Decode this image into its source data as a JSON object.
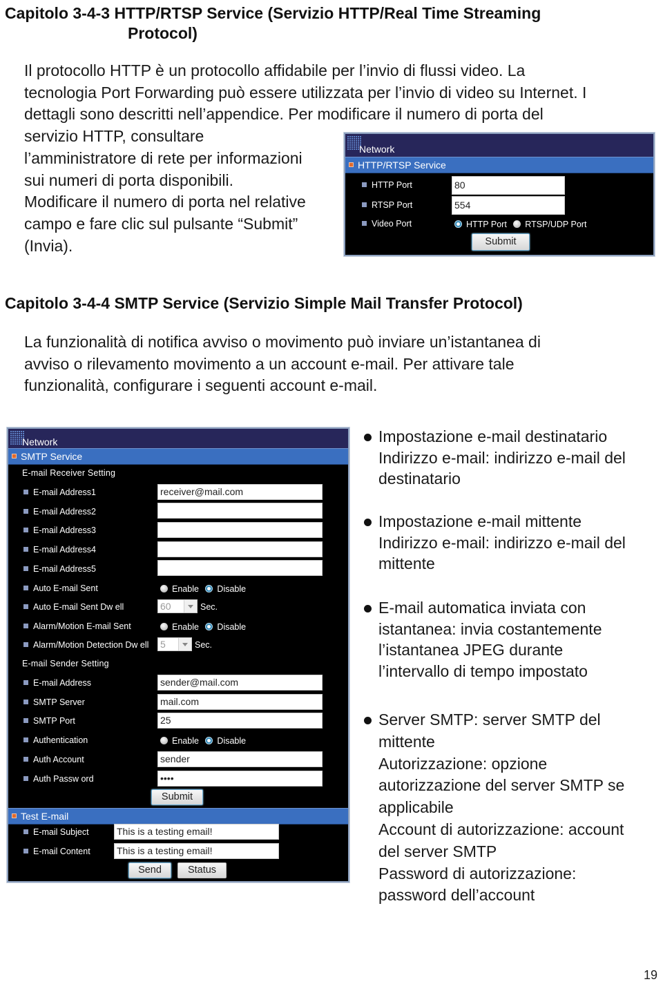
{
  "section1": {
    "title_line1": "Capitolo 3-4-3 HTTP/RTSP Service (Servizio HTTP/Real Time Streaming",
    "title_line2": "Protocol)",
    "paragraph_lines": [
      "Il protocollo HTTP è un protocollo affidabile per l’invio di flussi video. La",
      "tecnologia Port Forwarding può essere utilizzata per l’invio di video su Internet. I",
      "dettagli sono descritti nell’appendice. Per modificare il numero di porta del",
      "servizio HTTP, consultare",
      "l’amministratore di rete per informazioni",
      "sui numeri di porta disponibili.",
      "Modificare il numero di porta nel relative",
      "campo e fare clic sul pulsante “Submit”",
      "(Invia)."
    ],
    "panel": {
      "header": "Network",
      "section_title": "HTTP/RTSP Service",
      "rows": [
        {
          "label": "HTTP Port",
          "value": "80"
        },
        {
          "label": "RTSP Port",
          "value": "554"
        }
      ],
      "video_port": {
        "label": "Video Port",
        "options": [
          "HTTP Port",
          "RTSP/UDP Port"
        ],
        "selected": "HTTP Port"
      },
      "submit_label": "Submit"
    }
  },
  "section2": {
    "title": "Capitolo 3-4-4 SMTP Service (Servizio Simple Mail Transfer Protocol)",
    "paragraph_lines": [
      "La funzionalità di notifica avviso o movimento può inviare un’istantanea di",
      "avviso o rilevamento movimento a un account e-mail. Per attivare tale",
      "funzionalità, configurare i seguenti account e-mail."
    ],
    "panel": {
      "header": "Network",
      "section_title": "SMTP Service",
      "receiver_heading": "E-mail Receiver Setting",
      "receiver_rows": [
        {
          "label": "E-mail Address1",
          "value": "receiver@mail.com"
        },
        {
          "label": "E-mail Address2",
          "value": ""
        },
        {
          "label": "E-mail Address3",
          "value": ""
        },
        {
          "label": "E-mail Address4",
          "value": ""
        },
        {
          "label": "E-mail Address5",
          "value": ""
        }
      ],
      "auto_email": {
        "label": "Auto E-mail Sent",
        "enable": "Enable",
        "disable": "Disable",
        "selected": "Disable"
      },
      "auto_dwell": {
        "label": "Auto E-mail Sent Dw ell",
        "value": "60",
        "unit": "Sec."
      },
      "alarm_email": {
        "label": "Alarm/Motion E-mail Sent",
        "enable": "Enable",
        "disable": "Disable",
        "selected": "Disable"
      },
      "alarm_dwell": {
        "label": "Alarm/Motion Detection Dw ell",
        "value": "5",
        "unit": "Sec."
      },
      "sender_heading": "E-mail Sender Setting",
      "sender_email": {
        "label": "E-mail Address",
        "value": "sender@mail.com"
      },
      "smtp_server": {
        "label": "SMTP Server",
        "value": "mail.com"
      },
      "smtp_port": {
        "label": "SMTP Port",
        "value": "25"
      },
      "authentication": {
        "label": "Authentication",
        "enable": "Enable",
        "disable": "Disable",
        "selected": "Disable"
      },
      "auth_account": {
        "label": "Auth Account",
        "value": "sender"
      },
      "auth_password": {
        "label": "Auth Passw ord",
        "value": "••••"
      },
      "submit_label": "Submit",
      "test_title": "Test E-mail",
      "test_subject": {
        "label": "E-mail Subject",
        "value": "This is a testing email!"
      },
      "test_content": {
        "label": "E-mail Content",
        "value": "This is a testing email!"
      },
      "send_label": "Send",
      "status_label": "Status"
    },
    "bullets": [
      {
        "lines": [
          "Impostazione e-mail destinatario",
          "Indirizzo e-mail: indirizzo e-mail del",
          "destinatario"
        ]
      },
      {
        "lines": [
          "Impostazione e-mail mittente",
          "Indirizzo e-mail: indirizzo e-mail del",
          "mittente"
        ]
      },
      {
        "lines": [
          "E-mail automatica inviata con",
          "istantanea: invia costantemente",
          "l’istantanea JPEG durante",
          "l’intervallo di tempo impostato"
        ]
      },
      {
        "lines": [
          "Server SMTP: server SMTP del",
          "mittente",
          "Autorizzazione: opzione",
          "autorizzazione del server SMTP se",
          "applicabile",
          "Account di autorizzazione: account",
          "del server SMTP",
          "Password di autorizzazione:",
          "password dell’account"
        ]
      }
    ]
  },
  "page_number": "19"
}
